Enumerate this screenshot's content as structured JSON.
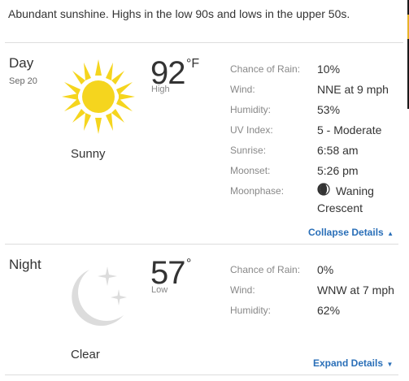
{
  "summary": "Abundant sunshine. Highs in the low 90s and lows in the upper 50s.",
  "day": {
    "label": "Day",
    "date": "Sep 20",
    "temp": "92",
    "unit": "°F",
    "temp_label": "High",
    "condition": "Sunny",
    "icon": "sun-icon",
    "details": [
      {
        "label": "Chance of Rain:",
        "value": "10%"
      },
      {
        "label": "Wind:",
        "value": "NNE at 9 mph"
      },
      {
        "label": "Humidity:",
        "value": "53%"
      },
      {
        "label": "UV Index:",
        "value": "5 - Moderate"
      },
      {
        "label": "Sunrise:",
        "value": "6:58 am"
      },
      {
        "label": "Moonset:",
        "value": "5:26 pm"
      },
      {
        "label": "Moonphase:",
        "value_line1": "Waning",
        "value_line2": "Crescent",
        "icon": "waning-crescent-moon-icon"
      }
    ],
    "toggle_label": "Collapse Details",
    "toggle_icon": "triangle-up-icon"
  },
  "night": {
    "label": "Night",
    "temp": "57",
    "unit": "°",
    "temp_label": "Low",
    "condition": "Clear",
    "icon": "moon-stars-icon",
    "details": [
      {
        "label": "Chance of Rain:",
        "value": "0%"
      },
      {
        "label": "Wind:",
        "value": "WNW at 7 mph"
      },
      {
        "label": "Humidity:",
        "value": "62%"
      }
    ],
    "toggle_label": "Expand Details",
    "toggle_icon": "triangle-down-icon"
  },
  "colors": {
    "sun": "#f5d51e",
    "moon": "#dcdcdc",
    "link": "#2a6fb8",
    "divider": "#dddddd"
  }
}
